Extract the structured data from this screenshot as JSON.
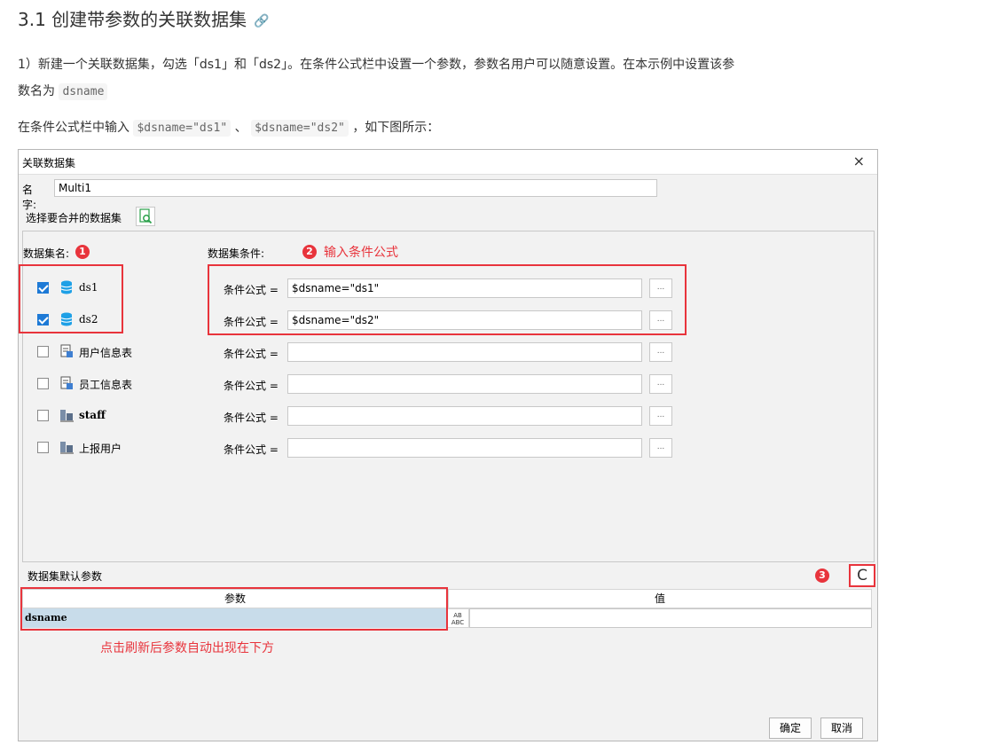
{
  "doc": {
    "title": "3.1 创建带参数的关联数据集",
    "link_icon": "🔗",
    "para1_line1": "1）新建一个关联数据集，勾选「ds1」和「ds2」。在条件公式栏中设置一个参数，参数名用户可以随意设置。在本示例中设置该参",
    "para1_line2_prefix": "数名为",
    "para1_code": "dsname",
    "para2_prefix": "在条件公式栏中输入",
    "para2_code1": "$dsname=\"ds1\"",
    "para2_sep": "、",
    "para2_code2": "$dsname=\"ds2\"",
    "para2_suffix": "，如下图所示："
  },
  "dialog": {
    "title": "关联数据集",
    "close_icon": "×",
    "name_label": "名字:",
    "name_value": "Multi1",
    "choose_label": "选择要合并的数据集",
    "col_dataset_label": "数据集名:",
    "col_condition_label": "数据集条件:",
    "datasets": [
      {
        "name": "ds1",
        "checked": true,
        "icon": "database-icon"
      },
      {
        "name": "ds2",
        "checked": true,
        "icon": "database-icon"
      },
      {
        "name": "用户信息表",
        "checked": false,
        "icon": "table-file-icon"
      },
      {
        "name": "员工信息表",
        "checked": false,
        "icon": "table-file-icon"
      },
      {
        "name": "staff",
        "checked": false,
        "icon": "server-dataset-icon"
      },
      {
        "name": "上报用户",
        "checked": false,
        "icon": "server-dataset-icon"
      }
    ],
    "condition_label": "条件公式 =",
    "conditions": [
      "$dsname=\"ds1\"",
      "$dsname=\"ds2\"",
      "",
      "",
      "",
      ""
    ],
    "more_btn": "...",
    "param_section_label": "数据集默认参数",
    "refresh_icon": "C",
    "param_header": "参数",
    "value_header": "值",
    "param_rows": [
      {
        "param": "dsname",
        "value": ""
      }
    ],
    "type_icon_text": "AB\nABC",
    "ok_label": "确定",
    "cancel_label": "取消"
  },
  "annotations": {
    "badge1": "1",
    "badge2": "2",
    "badge2_text": "输入条件公式",
    "badge3": "3",
    "bottom_note": "点击刷新后参数自动出现在下方",
    "color": "#e8343c"
  }
}
